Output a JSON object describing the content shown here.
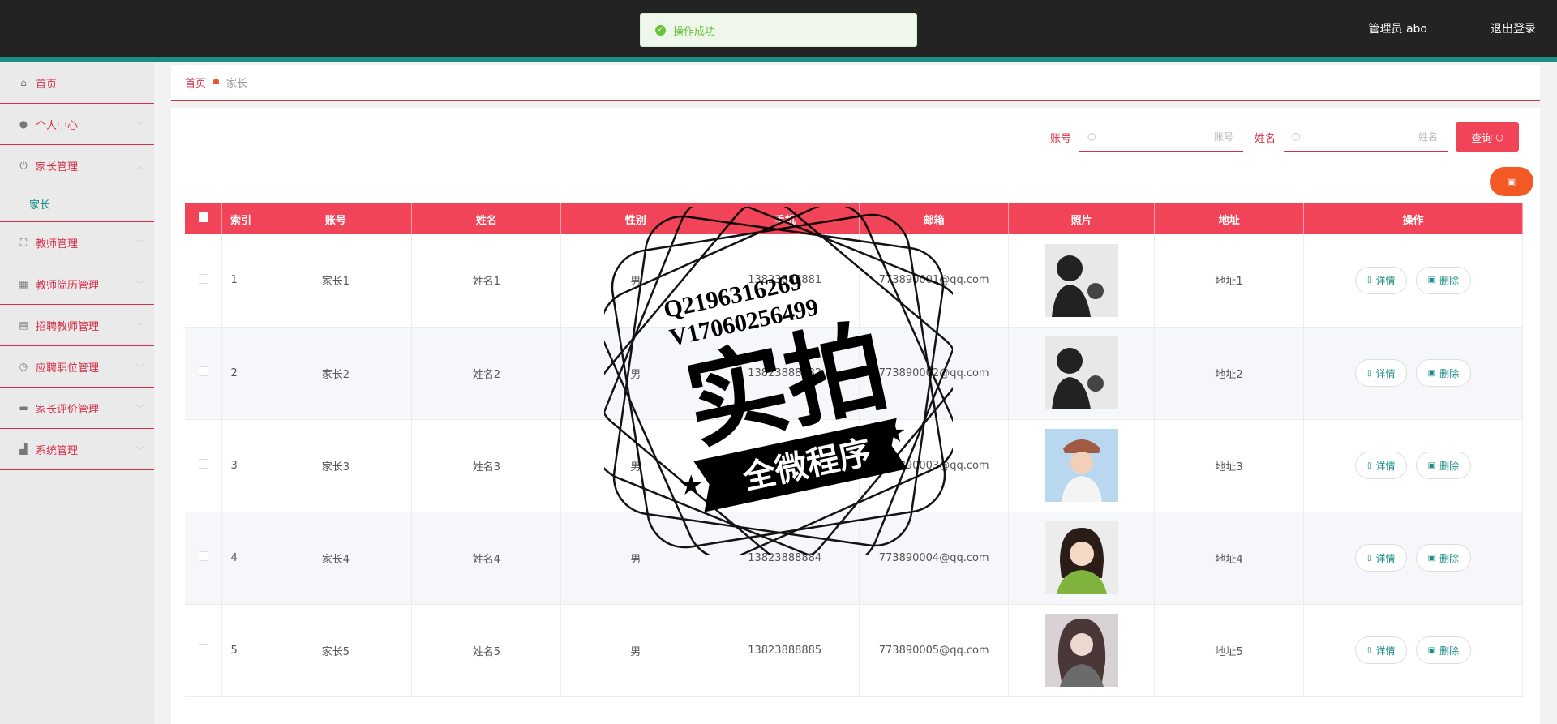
{
  "header": {
    "user_label": "管理员 abo",
    "logout_label": "退出登录"
  },
  "toast": {
    "message": "操作成功"
  },
  "sidebar": {
    "items": [
      {
        "label": "首页",
        "icon": "home-icon"
      },
      {
        "label": "个人中心",
        "icon": "user-icon"
      },
      {
        "label": "家长管理",
        "icon": "power-icon",
        "expanded": true
      },
      {
        "label": "教师管理",
        "icon": "fullscreen-icon"
      },
      {
        "label": "教师简历管理",
        "icon": "grid-icon"
      },
      {
        "label": "招聘教师管理",
        "icon": "chart-icon"
      },
      {
        "label": "应聘职位管理",
        "icon": "clock-icon"
      },
      {
        "label": "家长评价管理",
        "icon": "briefcase-icon"
      },
      {
        "label": "系统管理",
        "icon": "thumb-icon"
      }
    ],
    "submenu": {
      "label": "家长"
    }
  },
  "breadcrumb": {
    "home": "首页",
    "current": "家长"
  },
  "search": {
    "account_label": "账号",
    "account_placeholder": "账号",
    "name_label": "姓名",
    "name_placeholder": "姓名",
    "query_label": "查询"
  },
  "table": {
    "columns": [
      "索引",
      "账号",
      "姓名",
      "性别",
      "手机",
      "邮箱",
      "照片",
      "地址",
      "操作"
    ],
    "detail_label": "详情",
    "delete_label": "删除",
    "rows": [
      {
        "index": "1",
        "account": "家长1",
        "name": "姓名1",
        "gender": "男",
        "phone": "13823888881",
        "email": "773890001@qq.com",
        "address": "地址1"
      },
      {
        "index": "2",
        "account": "家长2",
        "name": "姓名2",
        "gender": "男",
        "phone": "13823888882",
        "email": "773890002@qq.com",
        "address": "地址2"
      },
      {
        "index": "3",
        "account": "家长3",
        "name": "姓名3",
        "gender": "男",
        "phone": "13823888883",
        "email": "773890003@qq.com",
        "address": "地址3"
      },
      {
        "index": "4",
        "account": "家长4",
        "name": "姓名4",
        "gender": "男",
        "phone": "13823888884",
        "email": "773890004@qq.com",
        "address": "地址4"
      },
      {
        "index": "5",
        "account": "家长5",
        "name": "姓名5",
        "gender": "男",
        "phone": "13823888885",
        "email": "773890005@qq.com",
        "address": "地址5"
      }
    ]
  },
  "watermark": {
    "line1": "Q2196316269",
    "line2": "V17060256499",
    "main": "实拍",
    "ribbon": "全微程序"
  },
  "colors": {
    "accent": "#f24458",
    "brand_teal": "#1a8d85",
    "topbar": "#232323",
    "menu_text": "#d6314a"
  }
}
